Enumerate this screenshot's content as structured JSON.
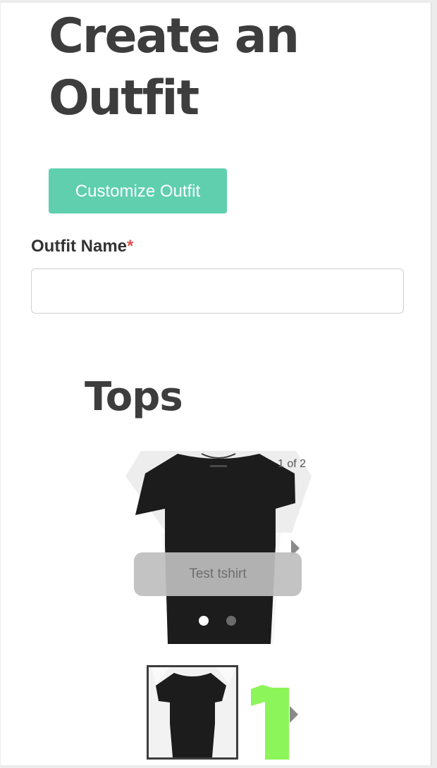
{
  "header": {
    "title": "Create an Outfit"
  },
  "actions": {
    "customize_label": "Customize Outfit"
  },
  "form": {
    "name_label": "Outfit Name",
    "required_mark": "*",
    "name_value": "",
    "name_placeholder": ""
  },
  "tops": {
    "title": "Tops",
    "counter": "1 of 2",
    "current_caption": "Test tshirt",
    "current_index": 1,
    "total": 2,
    "items": [
      {
        "color": "#1c1c1c",
        "icon": "tshirt-black-image"
      },
      {
        "color": "#8cf55a",
        "icon": "tshirt-green-image"
      }
    ]
  },
  "colors": {
    "accent": "#5fcfae",
    "title_text": "#3d3d3d",
    "required": "#d9534f"
  }
}
